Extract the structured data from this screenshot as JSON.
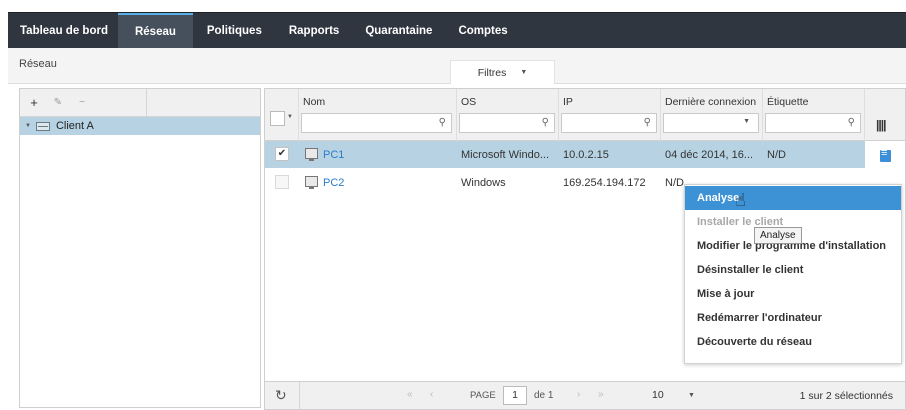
{
  "nav": {
    "tabs": [
      {
        "label": "Tableau de bord"
      },
      {
        "label": "Réseau"
      },
      {
        "label": "Politiques"
      },
      {
        "label": "Rapports"
      },
      {
        "label": "Quarantaine"
      },
      {
        "label": "Comptes"
      }
    ],
    "active": "Réseau"
  },
  "breadcrumb": "Réseau",
  "filters_label": "Filtres",
  "tree": {
    "toolbar": {
      "add": "+",
      "edit": "✎",
      "remove": "−"
    },
    "items": [
      {
        "label": "Client A"
      }
    ]
  },
  "grid": {
    "columns": [
      {
        "label": "Nom"
      },
      {
        "label": "OS"
      },
      {
        "label": "IP"
      },
      {
        "label": "Dernière connexion"
      },
      {
        "label": "Étiquette"
      }
    ],
    "rows": [
      {
        "name": "PC1",
        "os": "Microsoft Windo...",
        "ip": "10.0.2.15",
        "last_seen": "04 déc 2014, 16...",
        "label": "N/D",
        "selected": true
      },
      {
        "name": "PC2",
        "os": "Windows",
        "ip": "169.254.194.172",
        "last_seen": "N/D",
        "label": "",
        "selected": false
      }
    ],
    "footer": {
      "page_label": "PAGE",
      "page_value": "1",
      "of_label": "de 1",
      "page_size": "10",
      "count_text": "1 sur 2 sélectionnés"
    }
  },
  "context_menu": {
    "items": [
      {
        "label": "Analyse",
        "state": "highlighted"
      },
      {
        "label": "Installer le client",
        "state": "disabled"
      },
      {
        "label": "Modifier le programme d'installation",
        "state": "normal"
      },
      {
        "label": "Désinstaller le client",
        "state": "normal"
      },
      {
        "label": "Mise à jour",
        "state": "normal"
      },
      {
        "label": "Redémarrer l'ordinateur",
        "state": "normal"
      },
      {
        "label": "Découverte du réseau",
        "state": "normal"
      }
    ],
    "tooltip": "Analyse"
  },
  "colors": {
    "nav_bg": "#2f3640",
    "selection_bg": "#b7d3e3",
    "menu_highlight": "#3d92d6",
    "link": "#2a7cc7"
  }
}
